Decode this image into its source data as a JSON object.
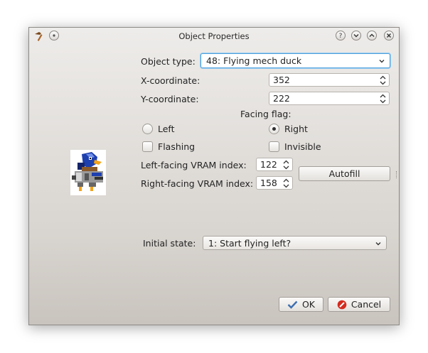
{
  "window": {
    "title": "Object Properties",
    "titlebar_buttons": [
      "help",
      "minimize",
      "maximize",
      "close"
    ]
  },
  "form": {
    "object_type_label": "Object type:",
    "object_type_value": "48: Flying mech duck",
    "x_label": "X-coordinate:",
    "x_value": "352",
    "y_label": "Y-coordinate:",
    "y_value": "222",
    "facing_label": "Facing flag:",
    "left_label": "Left",
    "right_label": "Right",
    "facing_selected": "Right",
    "flashing_label": "Flashing",
    "flashing_checked": false,
    "invisible_label": "Invisible",
    "invisible_checked": false,
    "left_vram_label": "Left-facing VRAM index:",
    "left_vram_value": "122",
    "right_vram_label": "Right-facing VRAM index:",
    "right_vram_value": "158",
    "autofill_label": "Autofill",
    "initial_state_label": "Initial state:",
    "initial_state_value": "1: Start flying left?"
  },
  "buttons": {
    "ok_label": "OK",
    "cancel_label": "Cancel"
  },
  "colors": {
    "focus_border": "#4fa0dc",
    "ok_check": "#3d6fb0",
    "cancel_icon": "#d42b1e"
  },
  "icons": {
    "app": "hammer-icon",
    "preview": "flying-mech-duck-sprite"
  }
}
